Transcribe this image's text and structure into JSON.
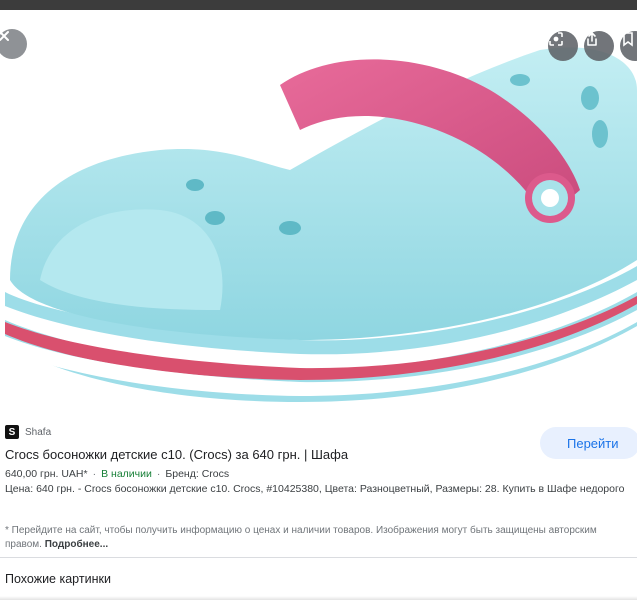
{
  "viewer": {
    "image_alt": "Crocs детские босоножки",
    "icons": {
      "close": "close-icon",
      "lens": "lens-icon",
      "share": "share-icon",
      "save": "bookmark-icon"
    }
  },
  "result": {
    "source_logo": "S",
    "source_name": "Shafa",
    "visit_label": "Перейти",
    "title": "Crocs босоножки детские с10. (Crocs) за 640 грн. | Шафа",
    "price": "640,00 грн. UAH*",
    "stock": "В наличии",
    "brand": "Бренд: Crocs",
    "description": "Цена: 640 грн. - Crocs босоножки детские с10. Crocs, #10425380, Цвета: Разноцветный, Размеры: 28. Купить в Шафе недорого",
    "notice": "* Перейдите на сайт, чтобы получить информацию о ценах и наличии товаров. Изображения могут быть защищены авторским правом.",
    "more_label": "Подробнее..."
  },
  "similar_label": "Похожие картинки",
  "colors": {
    "accent": "#1a73e8",
    "stock": "#188038",
    "sandal_body": "#a4e1ea",
    "sandal_strap": "#dc5a8c"
  }
}
